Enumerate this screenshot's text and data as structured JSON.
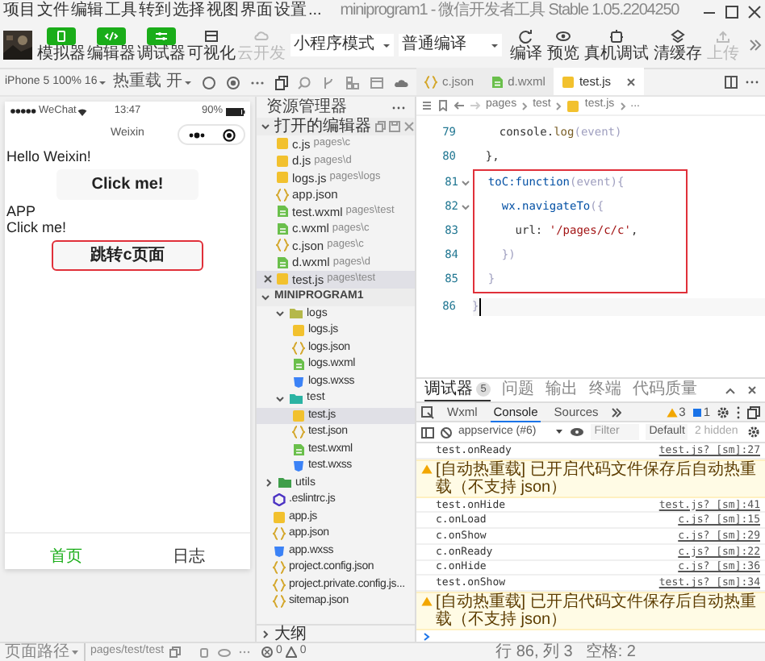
{
  "menu_bar": {
    "items": [
      "项目",
      "文件",
      "编辑",
      "工具",
      "转到",
      "选择",
      "视图",
      "界面",
      "设置",
      "..."
    ],
    "title": "miniprogram1 - 微信开发者工具 Stable 1.05.2204250"
  },
  "toolbar": {
    "mode_buttons": [
      {
        "label": "模拟器",
        "on": true,
        "disabled": false
      },
      {
        "label": "编辑器",
        "on": true,
        "disabled": false
      },
      {
        "label": "调试器",
        "on": true,
        "disabled": false
      },
      {
        "label": "可视化",
        "on": false,
        "disabled": false
      },
      {
        "label": "云开发",
        "on": false,
        "disabled": true
      }
    ],
    "selects": [
      {
        "value": "小程序模式"
      },
      {
        "value": "普通编译"
      }
    ],
    "actions": [
      {
        "label": "编译",
        "disabled": false
      },
      {
        "label": "预览",
        "disabled": false
      },
      {
        "label": "真机调试",
        "disabled": false
      },
      {
        "label": "清缓存",
        "disabled": false
      },
      {
        "label": "上传",
        "disabled": true
      }
    ]
  },
  "sim_controls": {
    "device": "iPhone 5 100% 16",
    "hot_reload": "热重载 开"
  },
  "editor_tabs": [
    {
      "label": "c.json",
      "kind": "json",
      "selected": false
    },
    {
      "label": "d.wxml",
      "kind": "wxml",
      "selected": false
    },
    {
      "label": "test.js",
      "kind": "js",
      "selected": true
    }
  ],
  "simulator": {
    "status": {
      "carrier": "WeChat",
      "time": "13:47",
      "battery": "90%"
    },
    "nav_title": "Weixin",
    "content": [
      {
        "kind": "text",
        "text": "Hello Weixin!"
      },
      {
        "kind": "button",
        "label": "Click me!",
        "highlighted": false
      },
      {
        "kind": "text",
        "text": "APP"
      },
      {
        "kind": "text",
        "text": "Click me!"
      },
      {
        "kind": "button",
        "label": "跳转c页面",
        "highlighted": true
      }
    ],
    "tabs": [
      {
        "label": "首页",
        "selected": true
      },
      {
        "label": "日志",
        "selected": false
      }
    ]
  },
  "page_path": {
    "label": "页面路径",
    "path": "pages/test/test"
  },
  "explorer": {
    "title": "资源管理器",
    "open_editors": {
      "title": "打开的编辑器",
      "items": [
        {
          "name": "c.js",
          "path": "pages\\c",
          "kind": "js",
          "selected": false
        },
        {
          "name": "d.js",
          "path": "pages\\d",
          "kind": "js",
          "selected": false
        },
        {
          "name": "logs.js",
          "path": "pages\\logs",
          "kind": "js",
          "selected": false
        },
        {
          "name": "app.json",
          "kind": "json",
          "selected": false
        },
        {
          "name": "test.wxml",
          "path": "pages\\test",
          "kind": "wxml",
          "selected": false
        },
        {
          "name": "c.wxml",
          "path": "pages\\c",
          "kind": "wxml",
          "selected": false
        },
        {
          "name": "c.json",
          "path": "pages\\c",
          "kind": "json",
          "selected": false
        },
        {
          "name": "d.wxml",
          "path": "pages\\d",
          "kind": "wxml",
          "selected": false
        },
        {
          "name": "test.js",
          "path": "pages\\test",
          "kind": "js",
          "selected": true
        }
      ]
    },
    "project": {
      "title": "MINIPROGRAM1",
      "items": [
        {
          "kind": "scrolled_folder",
          "children": [
            {
              "kind": "folder",
              "name": "logs",
              "expanded": true,
              "color": "#b5b84a",
              "children": [
                {
                  "kind": "js",
                  "name": "logs.js",
                  "selected": false
                },
                {
                  "kind": "json",
                  "name": "logs.json",
                  "selected": false
                },
                {
                  "kind": "wxml",
                  "name": "logs.wxml",
                  "selected": false
                },
                {
                  "kind": "wxss",
                  "name": "logs.wxss",
                  "selected": false
                }
              ]
            },
            {
              "kind": "folder",
              "name": "test",
              "expanded": true,
              "color": "#2bb3a3",
              "children": [
                {
                  "kind": "js",
                  "name": "test.js",
                  "selected": true
                },
                {
                  "kind": "json",
                  "name": "test.json",
                  "selected": false
                },
                {
                  "kind": "wxml",
                  "name": "test.wxml",
                  "selected": false
                },
                {
                  "kind": "wxss",
                  "name": "test.wxss",
                  "selected": false
                }
              ]
            }
          ]
        },
        {
          "kind": "folder",
          "name": "utils",
          "expanded": false,
          "color": "#3f9e4a"
        },
        {
          "kind": "eslint",
          "name": ".eslintrc.js",
          "selected": false
        },
        {
          "kind": "js",
          "name": "app.js",
          "selected": false
        },
        {
          "kind": "json",
          "name": "app.json",
          "selected": false
        },
        {
          "kind": "wxss",
          "name": "app.wxss",
          "selected": false
        },
        {
          "kind": "json",
          "name": "project.config.json",
          "selected": false
        },
        {
          "kind": "json",
          "name": "project.private.config.js...",
          "selected": false
        },
        {
          "kind": "json",
          "name": "sitemap.json",
          "selected": false
        }
      ]
    },
    "outline": "大纲",
    "problems": {
      "errors": "0",
      "warnings": "0"
    }
  },
  "editor": {
    "breadcrumb": [
      "pages",
      "test",
      "test.js",
      "..."
    ],
    "blocks": [
      {
        "boxed": false,
        "lines": [
          {
            "number": "79",
            "fold": false,
            "cursor": false,
            "tokens": [
              {
                "text": "    console.",
                "kind": "plain"
              },
              {
                "text": "log",
                "kind": "func"
              },
              {
                "text": "(event)",
                "kind": "punct"
              }
            ]
          },
          {
            "number": "80",
            "fold": false,
            "cursor": false,
            "tokens": [
              {
                "text": "  },",
                "kind": "plain"
              }
            ]
          }
        ]
      },
      {
        "boxed": true,
        "lines": [
          {
            "number": "81",
            "fold": true,
            "cursor": false,
            "tokens": [
              {
                "text": "  toC:function",
                "kind": "key"
              },
              {
                "text": "(event){",
                "kind": "punct"
              }
            ]
          },
          {
            "number": "82",
            "fold": true,
            "cursor": false,
            "tokens": [
              {
                "text": "    wx.navigateTo",
                "kind": "key"
              },
              {
                "text": "({",
                "kind": "punct"
              }
            ]
          },
          {
            "number": "83",
            "fold": false,
            "cursor": false,
            "tokens": [
              {
                "text": "      url: ",
                "kind": "plain"
              },
              {
                "text": "'/pages/c/c'",
                "kind": "string"
              },
              {
                "text": ",",
                "kind": "plain"
              }
            ]
          },
          {
            "number": "84",
            "fold": false,
            "cursor": false,
            "tokens": [
              {
                "text": "    })",
                "kind": "punct"
              }
            ]
          },
          {
            "number": "85",
            "fold": false,
            "cursor": false,
            "tokens": [
              {
                "text": "  }",
                "kind": "punct"
              }
            ]
          }
        ]
      },
      {
        "boxed": false,
        "lines": [
          {
            "number": "86",
            "fold": false,
            "cursor": true,
            "tokens": [
              {
                "text": "}",
                "kind": "punct"
              }
            ]
          }
        ]
      }
    ]
  },
  "debugger": {
    "tabs": [
      {
        "label": "调试器",
        "badge": "5",
        "selected": true
      },
      {
        "label": "问题",
        "selected": false
      },
      {
        "label": "输出",
        "selected": false
      },
      {
        "label": "终端",
        "selected": false
      },
      {
        "label": "代码质量",
        "selected": false
      }
    ],
    "panel_tabs": [
      {
        "label": "Wxml",
        "selected": false
      },
      {
        "label": "Console",
        "selected": true
      },
      {
        "label": "Sources",
        "selected": false
      }
    ],
    "warning_count": "3",
    "info_count": "1",
    "context": "appservice (#6)",
    "filter_placeholder": "Filter",
    "levels": "Default",
    "hidden": "2 hidden",
    "entries": [
      {
        "kind": "log",
        "text": "test.onReady",
        "source": "test.js? [sm]:27"
      },
      {
        "kind": "warning",
        "text": "[自动热重载] 已开启代码文件保存后自动热重载（不支持 json）"
      },
      {
        "kind": "log",
        "text": "test.onHide",
        "source": "test.js? [sm]:41"
      },
      {
        "kind": "log",
        "text": "c.onLoad",
        "source": "c.js? [sm]:15"
      },
      {
        "kind": "log",
        "text": "c.onShow",
        "source": "c.js? [sm]:29"
      },
      {
        "kind": "log",
        "text": "c.onReady",
        "source": "c.js? [sm]:22"
      },
      {
        "kind": "log",
        "text": "c.onHide",
        "source": "c.js? [sm]:36"
      },
      {
        "kind": "log",
        "text": "test.onShow",
        "source": "test.js? [sm]:34"
      },
      {
        "kind": "warning",
        "text": "[自动热重载] 已开启代码文件保存后自动热重载（不支持 json）"
      }
    ]
  },
  "status_bar": {
    "position": "行 86, 列 3",
    "indent": "空格: 2"
  }
}
